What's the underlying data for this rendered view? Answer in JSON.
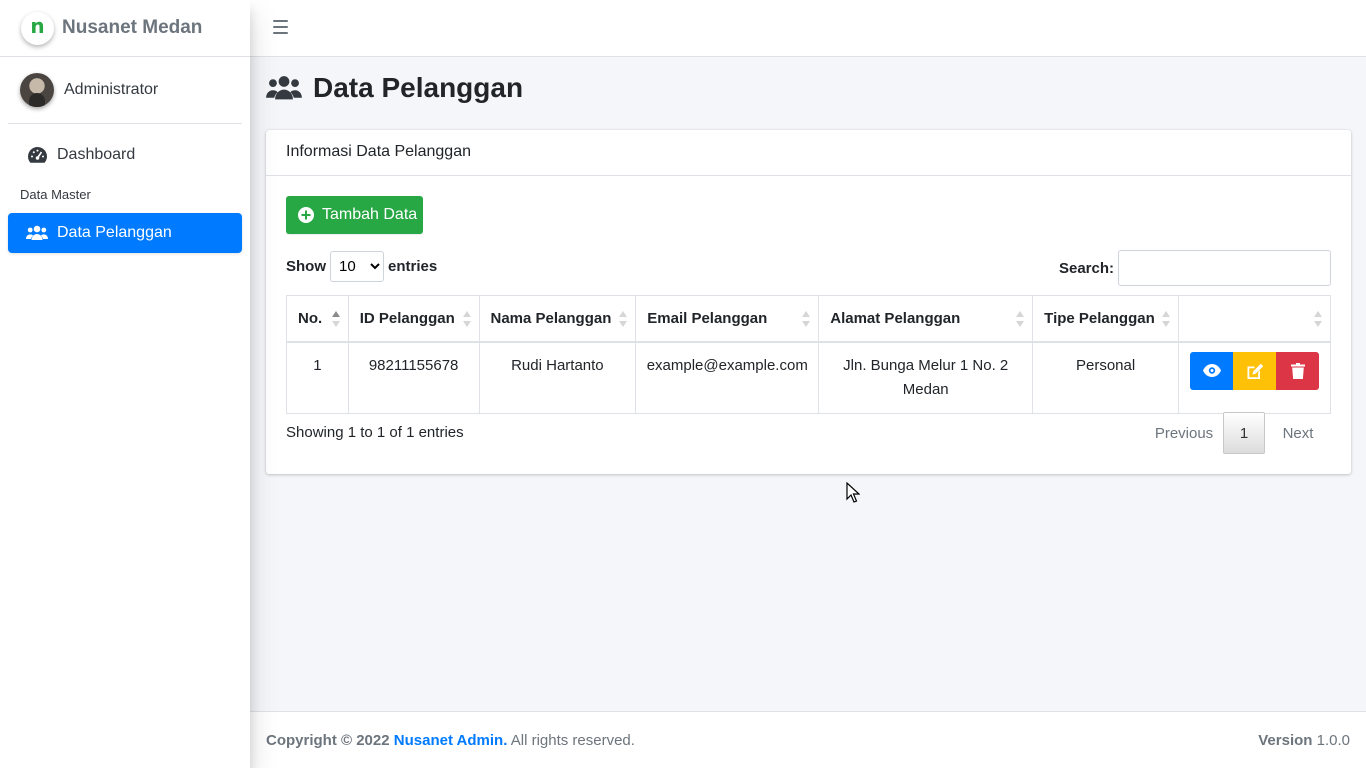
{
  "brand": {
    "logo_letter": "n",
    "name": "Nusanet Medan"
  },
  "user": {
    "name": "Administrator"
  },
  "sidebar": {
    "items": [
      {
        "label": "Dashboard",
        "icon": "tachometer-icon"
      },
      {
        "label": "Data Pelanggan",
        "icon": "users-icon",
        "active": true
      }
    ],
    "header": "Data Master"
  },
  "page": {
    "title": "Data Pelanggan"
  },
  "card": {
    "title": "Informasi Data Pelanggan",
    "add_button": "Tambah Data",
    "show_label": "Show",
    "entries_label": "entries",
    "page_length": "10",
    "page_length_options": [
      "10"
    ],
    "search_label": "Search:",
    "search_value": ""
  },
  "table": {
    "columns": [
      "No.",
      "ID Pelanggan",
      "Nama Pelanggan",
      "Email Pelanggan",
      "Alamat Pelanggan",
      "Tipe Pelanggan",
      ""
    ],
    "rows": [
      [
        "1",
        "98211155678",
        "Rudi Hartanto",
        "example@example.com",
        "Jln. Bunga Melur 1 No. 2 Medan",
        "Personal"
      ]
    ]
  },
  "table_info": "Showing 1 to 1 of 1 entries",
  "pagination": {
    "previous": "Previous",
    "current": "1",
    "next": "Next"
  },
  "footer": {
    "copyright": "Copyright © 2022",
    "company": "Nusanet Admin.",
    "rights": "All rights reserved.",
    "version_label": "Version",
    "version": "1.0.0"
  },
  "colors": {
    "primary": "#007bff",
    "success": "#28a745",
    "warning": "#ffc107",
    "danger": "#dc3545"
  }
}
